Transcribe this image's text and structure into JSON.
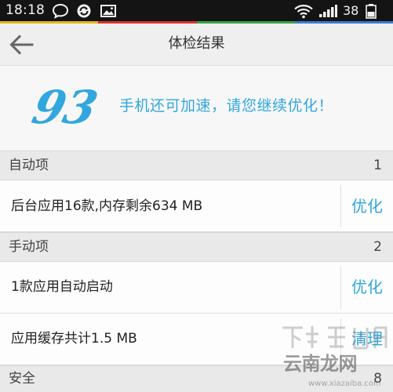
{
  "status_bar": {
    "time": "18:18",
    "battery_level": "38",
    "icons": [
      "message-icon",
      "sync-icon",
      "image-icon",
      "wifi-icon",
      "signal-icon",
      "battery-icon"
    ]
  },
  "title_bar": {
    "title": "体检结果",
    "back_icon": "back-arrow-icon"
  },
  "score": {
    "value": "93",
    "message": "手机还可加速，请您继续优化！"
  },
  "sections": [
    {
      "title": "自动项",
      "count": "1",
      "items": [
        {
          "label": "后台应用16款,内存剩余634 MB",
          "action": "优化"
        }
      ]
    },
    {
      "title": "手动项",
      "count": "2",
      "items": [
        {
          "label": "1款应用自动启动",
          "action": "优化"
        },
        {
          "label": "应用缓存共计1.5 MB",
          "action": "清理"
        }
      ]
    },
    {
      "title": "安全",
      "count": "8",
      "items": []
    }
  ],
  "watermark": {
    "brand": "云南龙网",
    "url": "www.xiazaiba.com"
  },
  "colors": {
    "accent": "#31a7dd",
    "status_bar_bg": "#141414",
    "header_bg": "#efefef",
    "section_bg": "#e9e9e9",
    "rainbow": [
      "#e5b81a",
      "#d9342b",
      "#35a34a",
      "#3a7bd5"
    ]
  }
}
